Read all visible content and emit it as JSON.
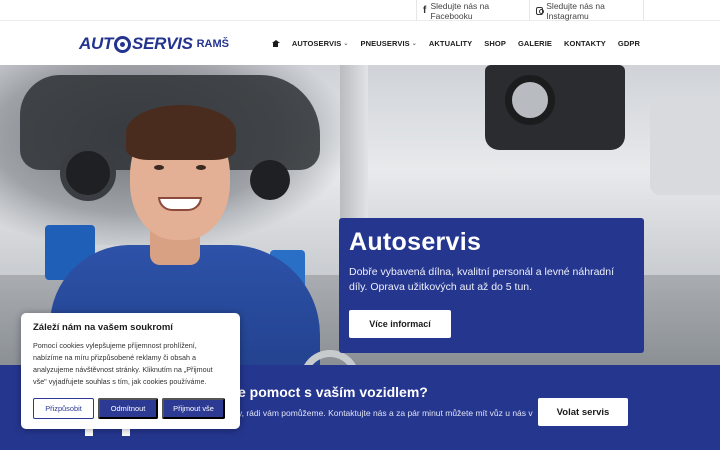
{
  "topbar": {
    "facebook_label": "Sledujte nás na Facebooku",
    "instagram_label": "Sledujte nás na Instagramu"
  },
  "header": {
    "logo_left": "AUT",
    "logo_right": "SERVIS",
    "logo_suffix": "RAMŠ",
    "nav": [
      {
        "label": "AUTOSERVIS",
        "dropdown": true
      },
      {
        "label": "PNEUSERVIS",
        "dropdown": true
      },
      {
        "label": "AKTUALITY",
        "dropdown": false
      },
      {
        "label": "SHOP",
        "dropdown": false
      },
      {
        "label": "GALERIE",
        "dropdown": false
      },
      {
        "label": "KONTAKTY",
        "dropdown": false
      },
      {
        "label": "GDPR",
        "dropdown": false
      }
    ]
  },
  "hero": {
    "title": "Autoservis",
    "text": "Dobře vybavená dílna, kvalitní personál a levné náhradní díly. Oprava užitkových aut až do 5 tun.",
    "button_label": "Více informací"
  },
  "band": {
    "title": "e pomoct s vaším vozidlem?",
    "text": "y, rádi vám pomůžeme. Kontaktujte nás a za pár minut můžete mít vůz u nás v",
    "button_label": "Volat servis"
  },
  "cookie": {
    "title": "Záleží nám na vašem soukromí",
    "text": "Pomocí cookies vylepšujeme příjemnost prohlížení, nabízíme na míru přizpůsobené reklamy či obsah a analyzujeme návštěvnost stránky. Kliknutím na „Přijmout vše\" vyjadřujete souhlas s tím, jak cookies používáme.",
    "customize_label": "Přizpůsobit",
    "reject_label": "Odmítnout",
    "accept_label": "Přijmout vše"
  },
  "colors": {
    "brand_blue": "#25368f",
    "button_blue": "#2c3a94"
  }
}
